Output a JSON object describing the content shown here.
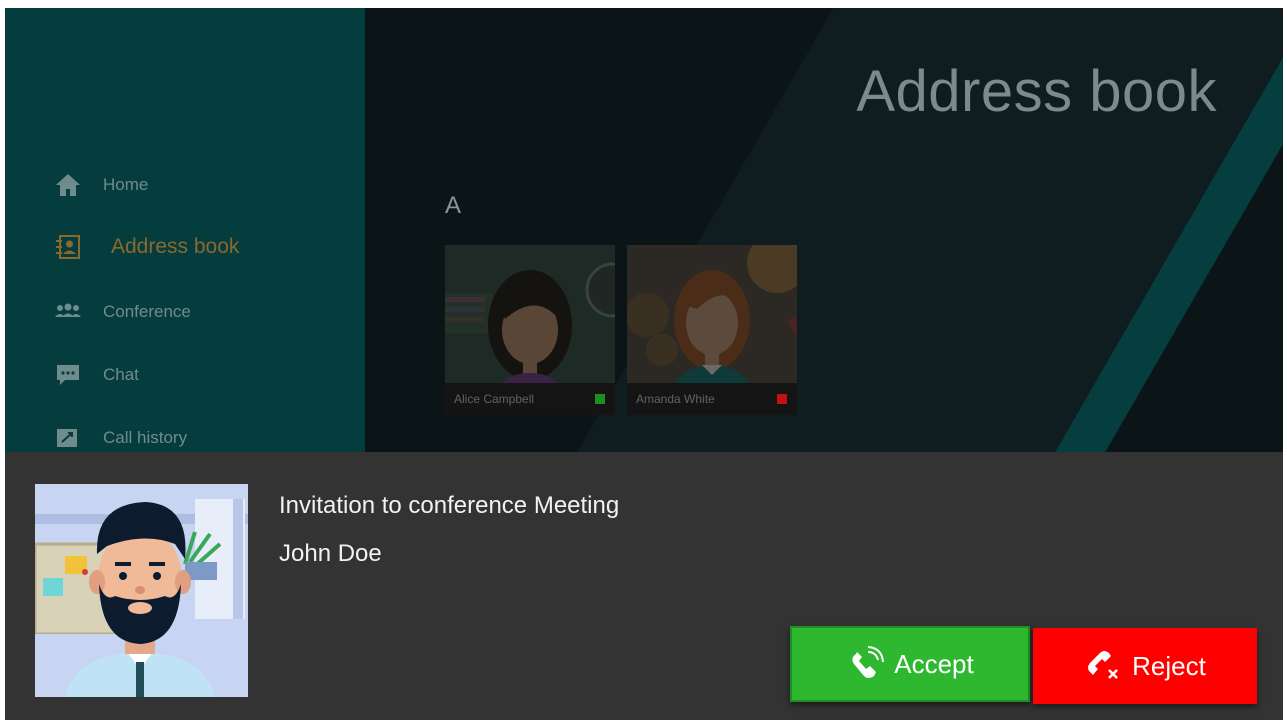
{
  "sidebar": {
    "items": [
      {
        "label": "Home",
        "icon": "home-icon"
      },
      {
        "label": "Address book",
        "icon": "address-book-icon",
        "active": true
      },
      {
        "label": "Conference",
        "icon": "conference-icon"
      },
      {
        "label": "Chat",
        "icon": "chat-icon"
      },
      {
        "label": "Call history",
        "icon": "call-history-icon"
      }
    ]
  },
  "main": {
    "title": "Address book",
    "section_letter": "A",
    "contacts": [
      {
        "name": "Alice Campbell",
        "status_color": "#1f8f22"
      },
      {
        "name": "Amanda White",
        "status_color": "#c41212"
      }
    ]
  },
  "invitation": {
    "title": "Invitation to conference Meeting",
    "caller": "John Doe",
    "accept_label": "Accept",
    "reject_label": "Reject"
  },
  "colors": {
    "accept": "#2db830",
    "reject": "#fe0000",
    "sidebar": "#053d3f",
    "active_item": "#8a6a2c"
  }
}
